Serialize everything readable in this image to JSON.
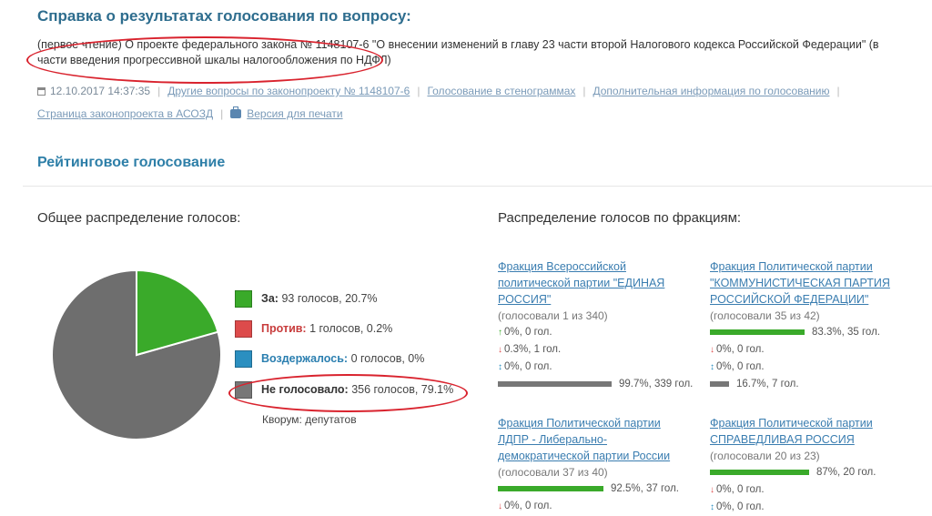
{
  "title": "Справка о результатах голосования по вопросу:",
  "description": "(первое чтение) О проекте федерального закона № 1148107-6 \"О внесении изменений в главу 23 части второй Налогового кодекса Российской Федерации\" (в части введения прогрессивной шкалы налогообложения по НДФЛ)",
  "meta": {
    "datetime": "12.10.2017 14:37:35",
    "link_other_questions": "Другие вопросы по законопроекту № 1148107-6",
    "link_transcripts": "Голосование в стенограммах",
    "link_additional_info": "Дополнительная информация по голосованию",
    "link_asozd": "Страница законопроекта в АСОЗД",
    "link_print": "Версия для печати"
  },
  "rating_heading": "Рейтинговое голосование",
  "overall": {
    "heading": "Общее распределение голосов:",
    "legend": [
      {
        "label": "За:",
        "value": "93 голосов, 20.7%",
        "color": "#3aaa2a",
        "label_color": "#333333"
      },
      {
        "label": "Против:",
        "value": "1 голосов, 0.2%",
        "color": "#dd4b4b",
        "label_color": "#c83c3c"
      },
      {
        "label": "Воздержалось:",
        "value": "0 голосов, 0%",
        "color": "#2b8fc0",
        "label_color": "#2b7fb0"
      },
      {
        "label": "Не голосовало:",
        "value": "356 голосов, 79.1%",
        "color": "#777777",
        "label_color": "#333333"
      }
    ],
    "quorum": "Кворум: депутатов"
  },
  "factions_heading": "Распределение голосов по фракциям:",
  "factions": [
    {
      "name": "Фракция Всероссийской политической партии \"ЕДИНАЯ РОССИЯ\"",
      "voted": "(голосовали 1 из 340)",
      "stats": [
        {
          "arrow": "↑",
          "text": "0%, 0 гол.",
          "color": "#3aaa2a",
          "pct": 0
        },
        {
          "arrow": "↓",
          "text": "0.3%, 1 гол.",
          "color": "#dd4b4b",
          "pct": 0.3
        },
        {
          "arrow": "↕",
          "text": "0%, 0 гол.",
          "color": "#2b8fc0",
          "pct": 0
        },
        {
          "arrow": "",
          "text": "99.7%, 339 гол.",
          "color": "#777777",
          "pct": 99.7
        }
      ]
    },
    {
      "name": "Фракция Политической партии \"КОММУНИСТИЧЕСКАЯ ПАРТИЯ РОССИЙСКОЙ ФЕДЕРАЦИИ\"",
      "voted": "(голосовали 35 из 42)",
      "stats": [
        {
          "arrow": "",
          "text": "83.3%, 35 гол.",
          "color": "#3aaa2a",
          "pct": 83.3
        },
        {
          "arrow": "↓",
          "text": "0%, 0 гол.",
          "color": "#dd4b4b",
          "pct": 0
        },
        {
          "arrow": "↕",
          "text": "0%, 0 гол.",
          "color": "#2b8fc0",
          "pct": 0
        },
        {
          "arrow": "",
          "text": "16.7%, 7 гол.",
          "color": "#777777",
          "pct": 16.7
        }
      ]
    },
    {
      "name": "Фракция Политической партии ЛДПР - Либерально-демократической партии России",
      "voted": "(голосовали 37 из 40)",
      "stats": [
        {
          "arrow": "",
          "text": "92.5%, 37 гол.",
          "color": "#3aaa2a",
          "pct": 92.5
        },
        {
          "arrow": "↓",
          "text": "0%, 0 гол.",
          "color": "#dd4b4b",
          "pct": 0
        }
      ]
    },
    {
      "name": "Фракция Политической партии СПРАВЕДЛИВАЯ РОССИЯ",
      "voted": "(голосовали 20 из 23)",
      "stats": [
        {
          "arrow": "",
          "text": "87%, 20 гол.",
          "color": "#3aaa2a",
          "pct": 87
        },
        {
          "arrow": "↓",
          "text": "0%, 0 гол.",
          "color": "#dd4b4b",
          "pct": 0
        },
        {
          "arrow": "↕",
          "text": "0%, 0 гол.",
          "color": "#2b8fc0",
          "pct": 0
        }
      ]
    }
  ]
}
